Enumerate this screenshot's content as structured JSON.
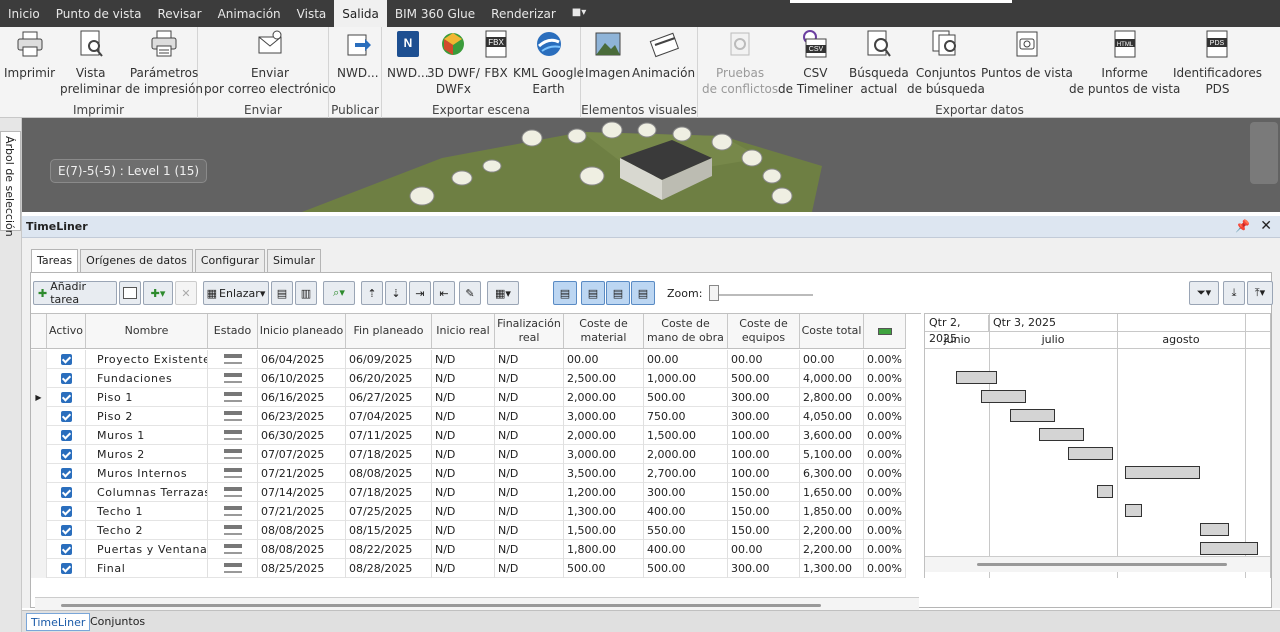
{
  "menubar": {
    "tabs": [
      "Inicio",
      "Punto de vista",
      "Revisar",
      "Animación",
      "Vista",
      "Salida",
      "BIM 360 Glue",
      "Renderizar"
    ],
    "active_tab": "Salida",
    "status_label": "▾"
  },
  "ribbon": {
    "groups": [
      {
        "title": "Imprimir",
        "buttons": [
          {
            "label1": "Imprimir",
            "label2": "",
            "icon": "printer-icon"
          },
          {
            "label1": "Vista",
            "label2": "preliminar",
            "icon": "print-preview-icon"
          },
          {
            "label1": "Parámetros",
            "label2": "de impresión",
            "icon": "print-settings-icon"
          }
        ]
      },
      {
        "title": "Enviar",
        "buttons": [
          {
            "label1": "Enviar",
            "label2": "por correo electrónico",
            "icon": "email-icon"
          }
        ]
      },
      {
        "title": "Publicar",
        "buttons": [
          {
            "label1": "NWD...",
            "label2": "",
            "icon": "publish-icon"
          }
        ]
      },
      {
        "title": "Exportar escena",
        "buttons": [
          {
            "label1": "NWD...",
            "label2": "",
            "icon": "nwd-icon"
          },
          {
            "label1": "3D DWF/",
            "label2": "DWFx",
            "icon": "dwf-icon"
          },
          {
            "label1": "FBX",
            "label2": "",
            "icon": "fbx-icon"
          },
          {
            "label1": "KML Google",
            "label2": "Earth",
            "icon": "google-earth-icon"
          }
        ]
      },
      {
        "title": "Elementos visuales",
        "buttons": [
          {
            "label1": "Imagen",
            "label2": "",
            "icon": "image-icon"
          },
          {
            "label1": "Animación",
            "label2": "",
            "icon": "film-icon"
          }
        ]
      },
      {
        "title": "Exportar datos",
        "buttons": [
          {
            "label1": "Pruebas",
            "label2": "de conflictos",
            "icon": "clash-test-icon",
            "disabled": true
          },
          {
            "label1": "CSV",
            "label2": "de Timeliner",
            "icon": "csv-icon"
          },
          {
            "label1": "Búsqueda",
            "label2": "actual",
            "icon": "search-doc-icon"
          },
          {
            "label1": "Conjuntos",
            "label2": "de búsqueda",
            "icon": "search-sets-icon"
          },
          {
            "label1": "Puntos de vista",
            "label2": "",
            "icon": "viewpoints-icon"
          },
          {
            "label1": "Informe",
            "label2": "de puntos de vista",
            "icon": "html-report-icon"
          },
          {
            "label1": "Identificadores",
            "label2": "PDS",
            "icon": "pds-icon"
          }
        ]
      }
    ]
  },
  "left_panel": {
    "tab_label": "Árbol de selección"
  },
  "viewport": {
    "label": "E(7)-5(-5) : Level 1 (15)"
  },
  "timeliner": {
    "title": "TimeLiner",
    "tabs": [
      "Tareas",
      "Orígenes de datos",
      "Configurar",
      "Simular"
    ],
    "active_tab": "Tareas",
    "toolbar": {
      "add_task": "Añadir tarea",
      "link": "Enlazar",
      "zoom_label": "Zoom:"
    },
    "columns": [
      "Activo",
      "Nombre",
      "Estado",
      "Inicio planeado",
      "Fin planeado",
      "Inicio real",
      "Finalización real",
      "Coste de material",
      "Coste de mano de obra",
      "Coste de equipos",
      "Coste total",
      ""
    ],
    "rows": [
      {
        "name": "Proyecto Existente",
        "start": "06/04/2025",
        "end": "06/09/2025",
        "real_start": "N/D",
        "real_end": "N/D",
        "material": "00.00",
        "labor": "00.00",
        "equipment": "00.00",
        "total": "00.00",
        "pct": "0.00%"
      },
      {
        "name": "Fundaciones",
        "start": "06/10/2025",
        "end": "06/20/2025",
        "real_start": "N/D",
        "real_end": "N/D",
        "material": "2,500.00",
        "labor": "1,000.00",
        "equipment": "500.00",
        "total": "4,000.00",
        "pct": "0.00%"
      },
      {
        "name": "Piso 1",
        "start": "06/16/2025",
        "end": "06/27/2025",
        "real_start": "N/D",
        "real_end": "N/D",
        "material": "2,000.00",
        "labor": "500.00",
        "equipment": "300.00",
        "total": "2,800.00",
        "pct": "0.00%"
      },
      {
        "name": "Piso 2",
        "start": "06/23/2025",
        "end": "07/04/2025",
        "real_start": "N/D",
        "real_end": "N/D",
        "material": "3,000.00",
        "labor": "750.00",
        "equipment": "300.00",
        "total": "4,050.00",
        "pct": "0.00%"
      },
      {
        "name": "Muros 1",
        "start": "06/30/2025",
        "end": "07/11/2025",
        "real_start": "N/D",
        "real_end": "N/D",
        "material": "2,000.00",
        "labor": "1,500.00",
        "equipment": "100.00",
        "total": "3,600.00",
        "pct": "0.00%"
      },
      {
        "name": "Muros 2",
        "start": "07/07/2025",
        "end": "07/18/2025",
        "real_start": "N/D",
        "real_end": "N/D",
        "material": "3,000.00",
        "labor": "2,000.00",
        "equipment": "100.00",
        "total": "5,100.00",
        "pct": "0.00%"
      },
      {
        "name": "Muros Internos",
        "start": "07/21/2025",
        "end": "08/08/2025",
        "real_start": "N/D",
        "real_end": "N/D",
        "material": "3,500.00",
        "labor": "2,700.00",
        "equipment": "100.00",
        "total": "6,300.00",
        "pct": "0.00%"
      },
      {
        "name": "Columnas Terrazas",
        "start": "07/14/2025",
        "end": "07/18/2025",
        "real_start": "N/D",
        "real_end": "N/D",
        "material": "1,200.00",
        "labor": "300.00",
        "equipment": "150.00",
        "total": "1,650.00",
        "pct": "0.00%"
      },
      {
        "name": "Techo 1",
        "start": "07/21/2025",
        "end": "07/25/2025",
        "real_start": "N/D",
        "real_end": "N/D",
        "material": "1,300.00",
        "labor": "400.00",
        "equipment": "150.00",
        "total": "1,850.00",
        "pct": "0.00%"
      },
      {
        "name": "Techo 2",
        "start": "08/08/2025",
        "end": "08/15/2025",
        "real_start": "N/D",
        "real_end": "N/D",
        "material": "1,500.00",
        "labor": "550.00",
        "equipment": "150.00",
        "total": "2,200.00",
        "pct": "0.00%"
      },
      {
        "name": "Puertas y Ventanas",
        "start": "08/08/2025",
        "end": "08/22/2025",
        "real_start": "N/D",
        "real_end": "N/D",
        "material": "1,800.00",
        "labor": "400.00",
        "equipment": "00.00",
        "total": "2,200.00",
        "pct": "0.00%"
      },
      {
        "name": "Final",
        "start": "08/25/2025",
        "end": "08/28/2025",
        "real_start": "N/D",
        "real_end": "N/D",
        "material": "500.00",
        "labor": "500.00",
        "equipment": "300.00",
        "total": "1,300.00",
        "pct": "0.00%"
      }
    ],
    "current_row": 2,
    "gantt": {
      "quarters": [
        "Qtr 2, 2025",
        "Qtr 3, 2025"
      ],
      "months": [
        "junio",
        "julio",
        "agosto"
      ]
    }
  },
  "bottom_tabs": [
    "TimeLiner",
    "Conjuntos"
  ],
  "colors": {
    "accent": "#2a6ebd",
    "header_bg": "#dde6f1",
    "menubar_bg": "#3c3c3c"
  }
}
